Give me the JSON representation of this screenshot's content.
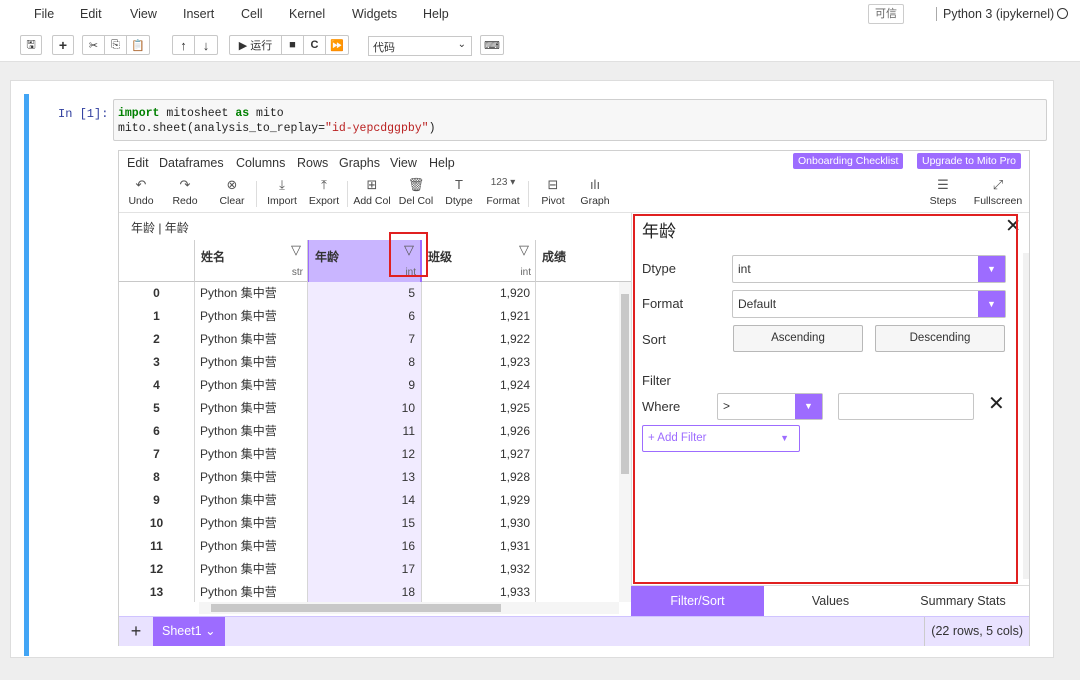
{
  "menubar": {
    "items": [
      "File",
      "Edit",
      "View",
      "Insert",
      "Cell",
      "Kernel",
      "Widgets",
      "Help"
    ],
    "trusted": "可信",
    "kernel": "Python 3 (ipykernel)"
  },
  "toolbar": {
    "run_label": "▶ 运行",
    "cell_type": "代码"
  },
  "cell": {
    "prompt": "In  [1]:",
    "line1_kw1": "import",
    "line1_mid": " mitosheet ",
    "line1_kw2": "as",
    "line1_end": " mito",
    "line2_start": "mito.sheet(analysis_to_replay=",
    "line2_str": "\"id-yepcdggpby\"",
    "line2_end": ")"
  },
  "mito": {
    "menu": [
      "Edit",
      "Dataframes",
      "Columns",
      "Rows",
      "Graphs",
      "View",
      "Help"
    ],
    "onboarding": "Onboarding Checklist",
    "upgrade": "Upgrade to Mito Pro",
    "tools": [
      "Undo",
      "Redo",
      "Clear",
      "Import",
      "Export",
      "Add Col",
      "Del Col",
      "Dtype",
      "Format",
      "Pivot",
      "Graph",
      "Steps",
      "Fullscreen"
    ],
    "format_icon": "123 ▾",
    "crumbs": "年龄 | 年龄",
    "columns": [
      {
        "name": "姓名",
        "dtype": "str"
      },
      {
        "name": "年龄",
        "dtype": "int"
      },
      {
        "name": "班级",
        "dtype": "int"
      },
      {
        "name": "成绩",
        "dtype": ""
      }
    ],
    "rows": [
      {
        "idx": "0",
        "name": "Python 集中营",
        "age": "5",
        "class": "1,920"
      },
      {
        "idx": "1",
        "name": "Python 集中营",
        "age": "6",
        "class": "1,921"
      },
      {
        "idx": "2",
        "name": "Python 集中营",
        "age": "7",
        "class": "1,922"
      },
      {
        "idx": "3",
        "name": "Python 集中营",
        "age": "8",
        "class": "1,923"
      },
      {
        "idx": "4",
        "name": "Python 集中营",
        "age": "9",
        "class": "1,924"
      },
      {
        "idx": "5",
        "name": "Python 集中营",
        "age": "10",
        "class": "1,925"
      },
      {
        "idx": "6",
        "name": "Python 集中营",
        "age": "11",
        "class": "1,926"
      },
      {
        "idx": "7",
        "name": "Python 集中营",
        "age": "12",
        "class": "1,927"
      },
      {
        "idx": "8",
        "name": "Python 集中营",
        "age": "13",
        "class": "1,928"
      },
      {
        "idx": "9",
        "name": "Python 集中营",
        "age": "14",
        "class": "1,929"
      },
      {
        "idx": "10",
        "name": "Python 集中营",
        "age": "15",
        "class": "1,930"
      },
      {
        "idx": "11",
        "name": "Python 集中营",
        "age": "16",
        "class": "1,931"
      },
      {
        "idx": "12",
        "name": "Python 集中营",
        "age": "17",
        "class": "1,932"
      },
      {
        "idx": "13",
        "name": "Python 集中营",
        "age": "18",
        "class": "1,933"
      }
    ],
    "add_sheet": "+",
    "sheet_tab": "Sheet1 ⌄",
    "sheet_info": "(22 rows, 5 cols)"
  },
  "taskpane": {
    "title": "年龄",
    "dtype_label": "Dtype",
    "dtype_value": "int",
    "format_label": "Format",
    "format_value": "Default",
    "sort_label": "Sort",
    "ascending": "Ascending",
    "descending": "Descending",
    "filter_label": "Filter",
    "where_label": "Where",
    "where_op": ">",
    "add_filter": "+ Add Filter",
    "tabs": [
      "Filter/Sort",
      "Values",
      "Summary Stats"
    ]
  },
  "colors": {
    "accent": "#9d6cff",
    "highlight": "#e02020",
    "cell_bar": "#42a5f5"
  }
}
